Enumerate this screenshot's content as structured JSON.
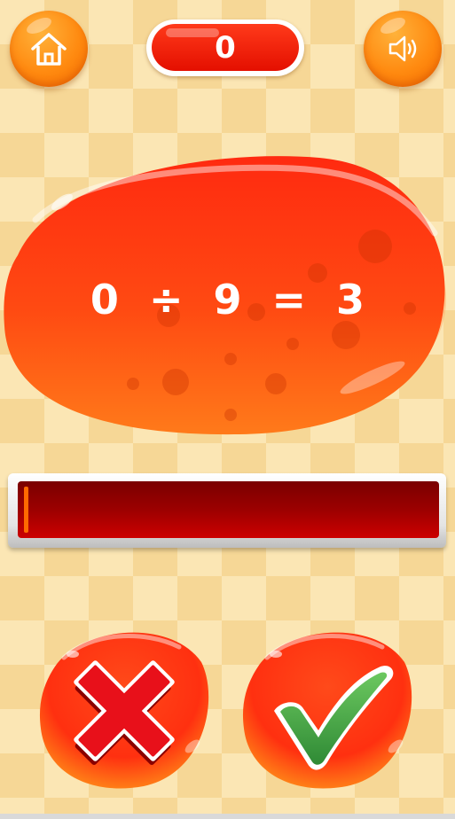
{
  "header": {
    "home_icon": "home-icon",
    "sound_icon": "speaker-icon",
    "score": "0"
  },
  "question": {
    "operand_a": "0",
    "operator": "÷",
    "operand_b": "9",
    "equals": "=",
    "result": "3"
  },
  "timer": {
    "fill_fraction": 0.01
  },
  "answers": {
    "wrong_icon": "cross-icon",
    "right_icon": "check-icon"
  },
  "colors": {
    "button_orange": "#ff8a10",
    "score_red": "#e40f00",
    "timer_red": "#9c0000",
    "check_green": "#3a9a3a",
    "cross_red": "#e8101a"
  }
}
